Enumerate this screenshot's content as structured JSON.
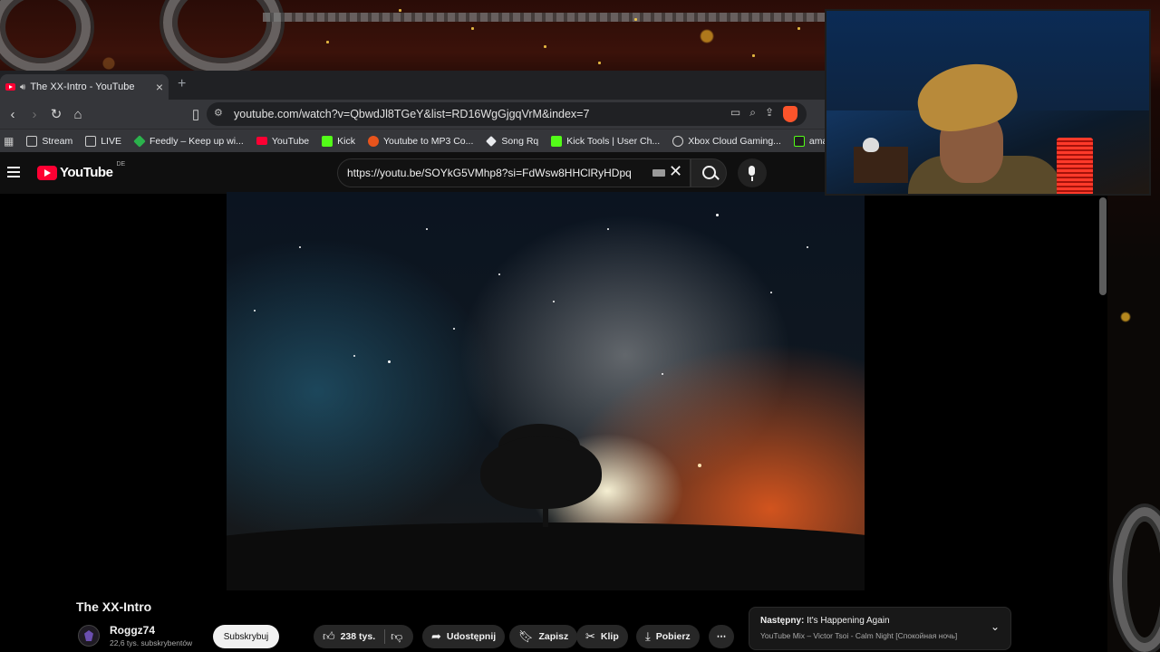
{
  "browser": {
    "tab": {
      "title": "The XX-Intro - YouTube"
    },
    "new_tab_label": "+",
    "address_url": "youtube.com/watch?v=QbwdJl8TGeY&list=RD16WgGjgqVrM&index=7",
    "bookmarks": [
      {
        "label": "Stream",
        "icon": "folder-icon"
      },
      {
        "label": "LIVE",
        "icon": "folder-icon"
      },
      {
        "label": "Feedly – Keep up wi...",
        "icon": "feedly-icon",
        "color": "#2bb24c"
      },
      {
        "label": "YouTube",
        "icon": "youtube-icon",
        "color": "#ff0033"
      },
      {
        "label": "Kick",
        "icon": "kick-icon",
        "color": "#53fc18"
      },
      {
        "label": "Youtube to MP3 Co...",
        "icon": "converter-icon",
        "color": "#e8541c"
      },
      {
        "label": "Song Rq",
        "icon": "diamond-icon",
        "color": "#e8eaed"
      },
      {
        "label": "Kick Tools | User Ch...",
        "icon": "kick-icon",
        "color": "#53fc18"
      },
      {
        "label": "Xbox Cloud Gaming...",
        "icon": "xbox-icon",
        "color": "#d0d0d0"
      },
      {
        "label": "amadixx - strea",
        "icon": "stream-icon",
        "color": "#1f1f1f"
      }
    ]
  },
  "youtube": {
    "logo_text": "YouTube",
    "logo_country": "DE",
    "search_value": "https://youtu.be/SOYkG5VMhp8?si=FdWsw8HHClRyHDpq",
    "video": {
      "title": "The XX-Intro",
      "channel": "Roggz74",
      "subscribers": "22,6 tys. subskrybentów",
      "subscribe_label": "Subskrybuj",
      "like_count": "238 tys.",
      "share_label": "Udostępnij",
      "save_label": "Zapisz",
      "clip_label": "Klip",
      "download_label": "Pobierz",
      "more_label": "⋯"
    },
    "next_up": {
      "prefix": "Następny:",
      "title": "It's Happening Again",
      "subtitle": "YouTube Mix – Victor Tsoi - Calm Night [Спокойная ночь]"
    }
  },
  "colors": {
    "brand_red": "#ff0033",
    "page_bg": "#0f0f0f",
    "chrome_bg": "#35363a"
  }
}
